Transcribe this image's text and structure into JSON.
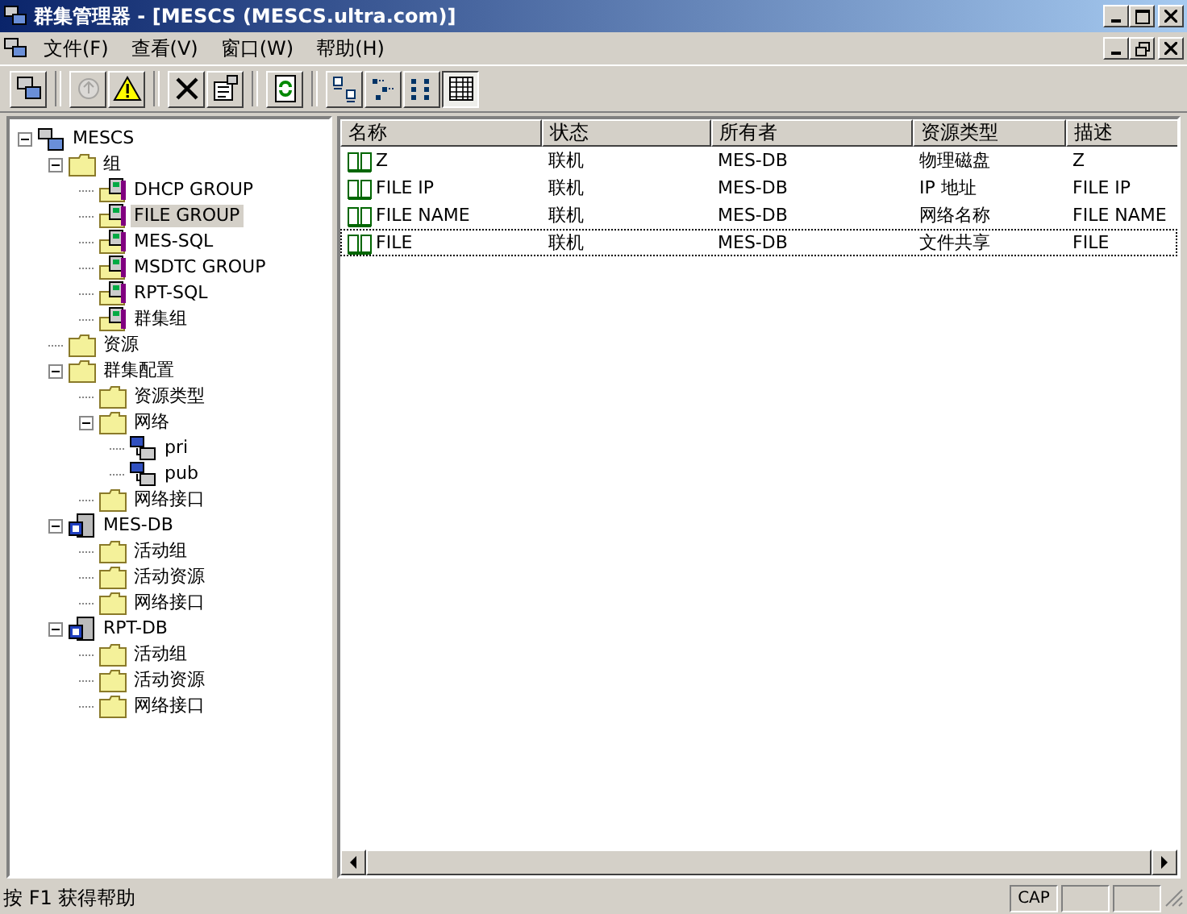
{
  "window": {
    "title": "群集管理器 - [MESCS (MESCS.ultra.com)]"
  },
  "menu": [
    {
      "label": "文件(F)"
    },
    {
      "label": "查看(V)"
    },
    {
      "label": "窗口(W)"
    },
    {
      "label": "帮助(H)"
    }
  ],
  "toolbar": [
    [
      {
        "kind": "cluster",
        "disabled": false,
        "pressed": false
      }
    ],
    [
      {
        "kind": "online",
        "disabled": true,
        "pressed": false
      },
      {
        "kind": "warning",
        "disabled": false,
        "pressed": false
      }
    ],
    [
      {
        "kind": "delete",
        "disabled": false,
        "pressed": false
      },
      {
        "kind": "properties",
        "disabled": false,
        "pressed": false
      }
    ],
    [
      {
        "kind": "refresh",
        "disabled": false,
        "pressed": false
      }
    ],
    [
      {
        "kind": "large",
        "disabled": false,
        "pressed": false
      },
      {
        "kind": "small",
        "disabled": false,
        "pressed": false
      },
      {
        "kind": "list",
        "disabled": false,
        "pressed": false
      },
      {
        "kind": "details",
        "disabled": false,
        "pressed": true
      }
    ]
  ],
  "tree": [
    {
      "label": "MESCS",
      "kind": "cluster",
      "selected": false,
      "expanded": true,
      "children": [
        {
          "label": "组",
          "kind": "folder",
          "selected": false,
          "expanded": true,
          "children": [
            {
              "label": "DHCP GROUP",
              "kind": "group",
              "selected": false
            },
            {
              "label": "FILE GROUP",
              "kind": "group",
              "selected": true
            },
            {
              "label": "MES-SQL",
              "kind": "group",
              "selected": false
            },
            {
              "label": "MSDTC GROUP",
              "kind": "group",
              "selected": false
            },
            {
              "label": "RPT-SQL",
              "kind": "group",
              "selected": false
            },
            {
              "label": "群集组",
              "kind": "group",
              "selected": false
            }
          ]
        },
        {
          "label": "资源",
          "kind": "folder",
          "selected": false
        },
        {
          "label": "群集配置",
          "kind": "folder",
          "selected": false,
          "expanded": true,
          "children": [
            {
              "label": "资源类型",
              "kind": "folder",
              "selected": false
            },
            {
              "label": "网络",
              "kind": "folder",
              "selected": false,
              "expanded": true,
              "children": [
                {
                  "label": "pri",
                  "kind": "network",
                  "selected": false
                },
                {
                  "label": "pub",
                  "kind": "network",
                  "selected": false
                }
              ]
            },
            {
              "label": "网络接口",
              "kind": "folder",
              "selected": false
            }
          ]
        },
        {
          "label": "MES-DB",
          "kind": "server",
          "selected": false,
          "expanded": true,
          "children": [
            {
              "label": "活动组",
              "kind": "folder",
              "selected": false
            },
            {
              "label": "活动资源",
              "kind": "folder",
              "selected": false
            },
            {
              "label": "网络接口",
              "kind": "folder",
              "selected": false
            }
          ]
        },
        {
          "label": "RPT-DB",
          "kind": "server",
          "selected": false,
          "expanded": true,
          "children": [
            {
              "label": "活动组",
              "kind": "folder",
              "selected": false
            },
            {
              "label": "活动资源",
              "kind": "folder",
              "selected": false
            },
            {
              "label": "网络接口",
              "kind": "folder",
              "selected": false
            }
          ]
        }
      ]
    }
  ],
  "table": {
    "columns": [
      "名称",
      "状态",
      "所有者",
      "资源类型",
      "描述"
    ],
    "rows": [
      {
        "cells": [
          "Z",
          "联机",
          "MES-DB",
          "物理磁盘",
          "Z"
        ],
        "focused": false
      },
      {
        "cells": [
          "FILE IP",
          "联机",
          "MES-DB",
          "IP 地址",
          "FILE IP"
        ],
        "focused": false
      },
      {
        "cells": [
          "FILE NAME",
          "联机",
          "MES-DB",
          "网络名称",
          "FILE NAME"
        ],
        "focused": false
      },
      {
        "cells": [
          "FILE",
          "联机",
          "MES-DB",
          "文件共享",
          "FILE"
        ],
        "focused": true
      }
    ]
  },
  "status_bar": {
    "text": "按 F1 获得帮助",
    "indicators": [
      "CAP"
    ]
  }
}
